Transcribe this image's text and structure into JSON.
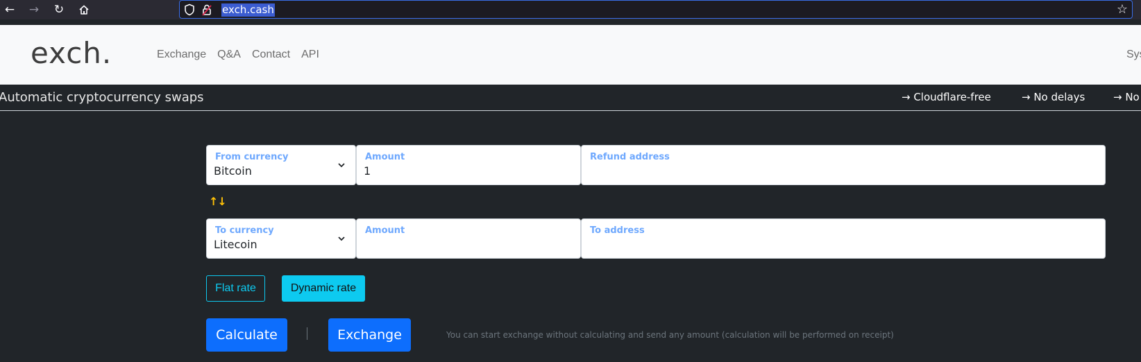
{
  "browser": {
    "url": "exch.cash"
  },
  "header": {
    "logo": "exch.",
    "nav": [
      "Exchange",
      "Q&A",
      "Contact",
      "API"
    ],
    "right_text": "Sys"
  },
  "tagline_bar": {
    "tagline": "Automatic cryptocurrency swaps",
    "features": [
      "→ Cloudflare-free",
      "→ No delays",
      "→ No"
    ]
  },
  "form": {
    "from_currency": {
      "label": "From currency",
      "value": "Bitcoin"
    },
    "from_amount": {
      "label": "Amount",
      "value": "1"
    },
    "refund_address": {
      "label": "Refund address",
      "value": ""
    },
    "swap_icon": "↑↓",
    "to_currency": {
      "label": "To currency",
      "value": "Litecoin"
    },
    "to_amount": {
      "label": "Amount",
      "value": ""
    },
    "to_address": {
      "label": "To address",
      "value": ""
    },
    "rate_flat": "Flat rate",
    "rate_dynamic": "Dynamic rate",
    "calculate": "Calculate",
    "exchange": "Exchange",
    "hint": "You can start exchange without calculating and send any amount (calculation will be performed on receipt)"
  },
  "colors": {
    "accent_blue": "#0d6efd",
    "accent_cyan": "#0dcaf0",
    "label_blue": "#6ea8fe",
    "swap_yellow": "#ffc107",
    "background_dark": "#212529"
  }
}
